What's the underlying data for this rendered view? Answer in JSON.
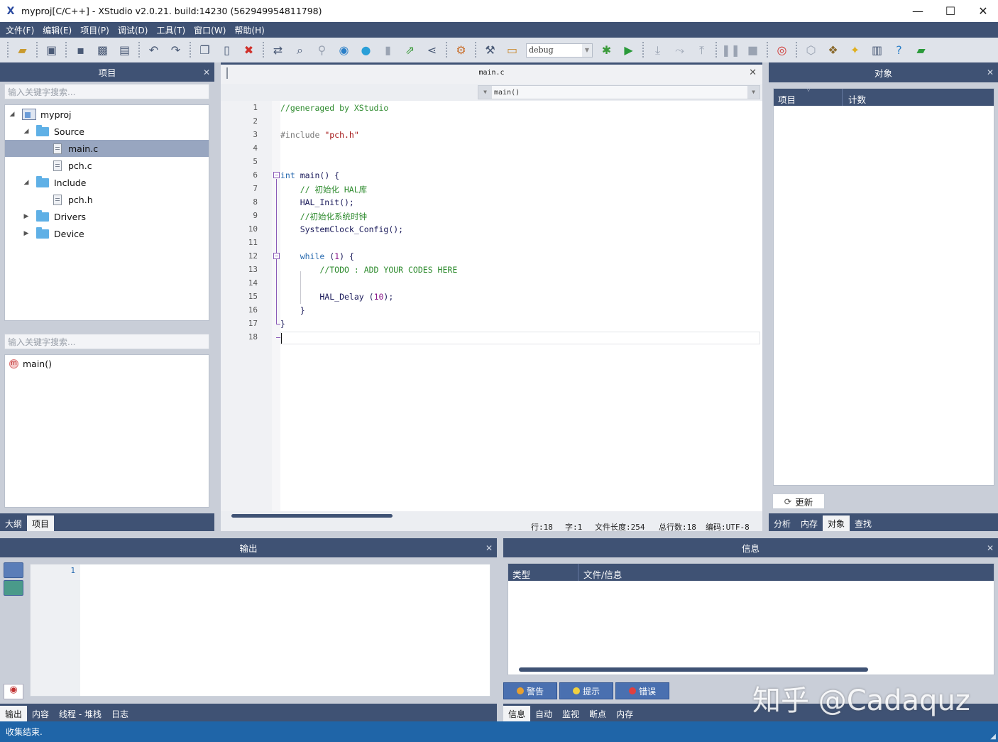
{
  "window": {
    "logo": "X",
    "title": "myproj[C/C++] - XStudio v2.0.21. build:14230 (562949954811798)",
    "minimize": "—",
    "maximize": "☐",
    "close": "✕"
  },
  "menu": [
    "文件(F)",
    "编辑(E)",
    "项目(P)",
    "调试(D)",
    "工具(T)",
    "窗口(W)",
    "帮助(H)"
  ],
  "toolbar": {
    "config": "debug"
  },
  "project_panel": {
    "title": "项目",
    "close": "✕",
    "search_placeholder": "输入关键字搜索...",
    "tree": [
      {
        "label": "myproj",
        "type": "project",
        "level": 0,
        "expanded": true
      },
      {
        "label": "Source",
        "type": "folder",
        "level": 1,
        "expanded": true
      },
      {
        "label": "main.c",
        "type": "file",
        "level": 2,
        "selected": true
      },
      {
        "label": "pch.c",
        "type": "file",
        "level": 2
      },
      {
        "label": "Include",
        "type": "folder",
        "level": 1,
        "expanded": true
      },
      {
        "label": "pch.h",
        "type": "file",
        "level": 2
      },
      {
        "label": "Drivers",
        "type": "folder",
        "level": 1,
        "expanded": false
      },
      {
        "label": "Device",
        "type": "folder",
        "level": 1,
        "expanded": false
      }
    ],
    "outline_search_placeholder": "输入关键字搜索...",
    "outline_badge": "m",
    "outline_items": [
      "main()"
    ],
    "tabs": [
      "大纲",
      "项目"
    ]
  },
  "editor": {
    "tab_title": "main.c",
    "close": "✕",
    "function": "main()",
    "lines": [
      "1",
      "2",
      "3",
      "4",
      "5",
      "6",
      "7",
      "8",
      "9",
      "10",
      "11",
      "12",
      "13",
      "14",
      "15",
      "16",
      "17",
      "18"
    ],
    "code": {
      "l1": "//generaged by XStudio",
      "l3_pre": "#include ",
      "l3_str": "\"pch.h\"",
      "l6_kw": "int",
      "l6_rest": " main() {",
      "l7": "    // 初始化 HAL库",
      "l8": "    HAL_Init();",
      "l9": "    //初始化系统时钟",
      "l10": "    SystemClock_Config();",
      "l12_kw": "    while",
      "l12_a": " (",
      "l12_num": "1",
      "l12_b": ") {",
      "l13": "        //TODO : ADD YOUR CODES HERE",
      "l15_a": "        HAL_Delay (",
      "l15_num": "10",
      "l15_b": ");",
      "l16": "    }",
      "l17": "}"
    },
    "status": {
      "row": "行:18",
      "col": "字:1",
      "length": "文件长度:254",
      "total": "总行数:18",
      "encoding": "编码:UTF-8"
    }
  },
  "object_panel": {
    "title": "对象",
    "close": "✕",
    "columns": [
      "项目",
      "计数"
    ],
    "refresh": "更新",
    "tabs": [
      "分析",
      "内存",
      "对象",
      "查找"
    ]
  },
  "output_panel": {
    "title": "输出",
    "close": "✕",
    "line_no": "1",
    "tabs": [
      "输出",
      "内容",
      "线程 - 堆栈",
      "日志"
    ]
  },
  "info_panel": {
    "title": "信息",
    "close": "✕",
    "columns": [
      "类型",
      "文件/信息"
    ],
    "filters": [
      "警告",
      "提示",
      "错误"
    ],
    "tabs": [
      "信息",
      "自动",
      "监视",
      "断点",
      "内存"
    ]
  },
  "statusbar": {
    "text": "收集结束."
  },
  "watermark": "知乎 @Cadaquz"
}
